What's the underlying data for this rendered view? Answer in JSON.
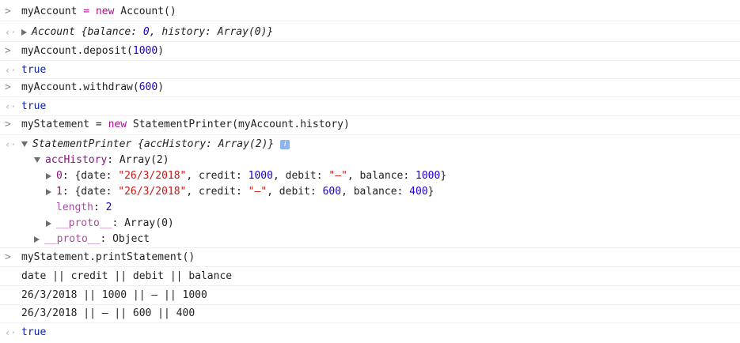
{
  "console": {
    "prompt_glyph": ">",
    "result_glyph": "‹·",
    "entries": [
      {
        "input": [
          "myAccount",
          " = ",
          "new",
          " Account()"
        ]
      },
      {
        "output_italic": "Account {balance: ",
        "output_num": "0",
        "output_rest": ", history: Array(0)}"
      },
      {
        "input_plain": "myAccount.deposit(",
        "input_num": "1000",
        "input_end": ")"
      },
      {
        "output_bool": "true"
      },
      {
        "input_plain": "myAccount.withdraw(",
        "input_num": "600",
        "input_end": ")"
      },
      {
        "output_bool": "true"
      },
      {
        "input_a": "myStatement = ",
        "input_kw": "new",
        "input_b": " StatementPrinter(myAccount.history)"
      },
      {
        "output_italic": "StatementPrinter {accHistory: Array(2)}",
        "badge": "i"
      },
      {
        "prop_name": "accHistory",
        "prop_value": ": Array(2)"
      },
      {
        "item0": {
          "idx": "0",
          "a": ": {date: ",
          "date": "\"26/3/2018\"",
          "b": ", credit: ",
          "credit": "1000",
          "c": ", debit: ",
          "debit": "\"–\"",
          "d": ", balance: ",
          "balance": "1000",
          "e": "}"
        }
      },
      {
        "item1": {
          "idx": "1",
          "a": ": {date: ",
          "date": "\"26/3/2018\"",
          "b": ", credit: ",
          "credit": "\"–\"",
          "c": ", debit: ",
          "debit": "600",
          "d": ", balance: ",
          "balance": "400",
          "e": "}"
        }
      },
      {
        "length_name": "length",
        "length_sep": ": ",
        "length_value": "2"
      },
      {
        "proto_arr_name": "__proto__",
        "proto_arr_value": ": Array(0)"
      },
      {
        "proto_obj_name": "__proto__",
        "proto_obj_value": ": Object"
      },
      {
        "input_plain": "myStatement.printStatement()"
      },
      {
        "log": "date || credit || debit || balance"
      },
      {
        "log": "26/3/2018 || 1000 || – || 1000"
      },
      {
        "log": "26/3/2018 || – || 600 || 400"
      },
      {
        "output_bool": "true"
      }
    ]
  }
}
